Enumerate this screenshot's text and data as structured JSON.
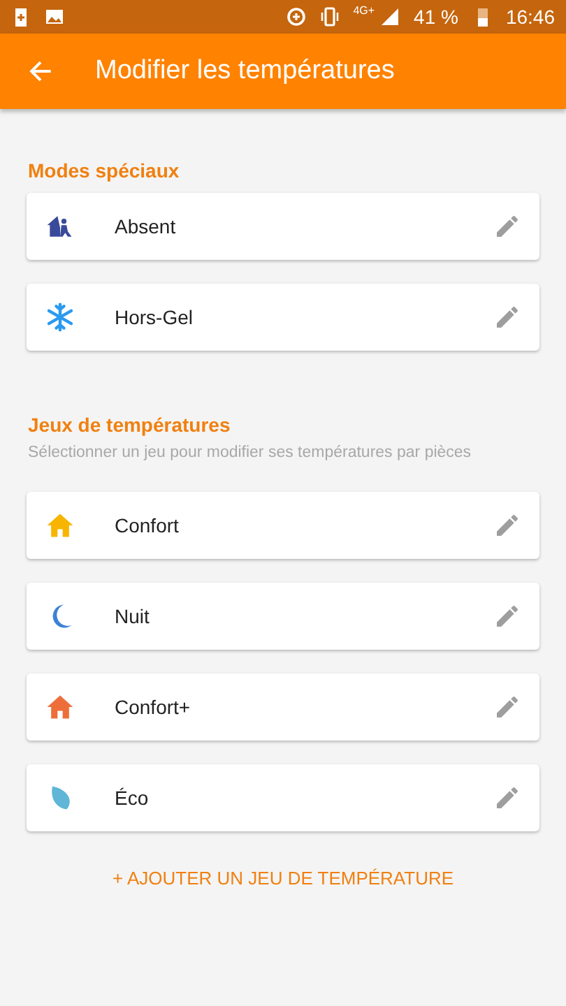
{
  "status_bar": {
    "network": "4G+",
    "battery": "41 %",
    "time": "16:46"
  },
  "app_bar": {
    "title": "Modifier les températures"
  },
  "sections": [
    {
      "title": "Modes spéciaux",
      "items": [
        {
          "label": "Absent",
          "kind": "absent"
        },
        {
          "label": "Hors-Gel",
          "kind": "frost"
        }
      ]
    },
    {
      "title": "Jeux de températures",
      "subtitle": "Sélectionner un jeu pour modifier ses températures par pièces",
      "items": [
        {
          "label": "Confort",
          "kind": "comfort"
        },
        {
          "label": "Nuit",
          "kind": "night"
        },
        {
          "label": "Confort+",
          "kind": "comfort-plus"
        },
        {
          "label": "Éco",
          "kind": "eco"
        }
      ]
    }
  ],
  "add_button": "+ AJOUTER UN JEU DE TEMPÉRATURE"
}
